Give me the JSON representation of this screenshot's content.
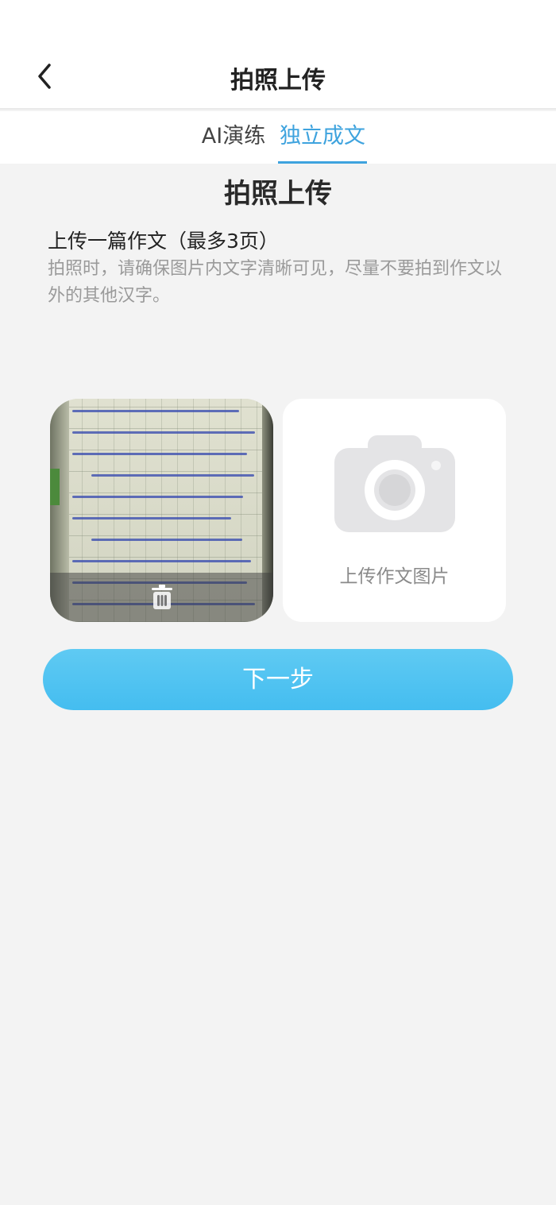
{
  "header": {
    "title": "拍照上传",
    "back_icon": "chevron-left-icon"
  },
  "tabs": [
    {
      "label": "AI演练",
      "active": false
    },
    {
      "label": "独立成文",
      "active": true
    }
  ],
  "main": {
    "section_title": "拍照上传",
    "upload_heading": "上传一篇作文（最多3页）",
    "upload_hint": "拍照时，请确保图片内文字清晰可见，尽量不要拍到作文以外的其他汉字。",
    "uploaded_images": [
      {
        "description_icon": "essay-photo-thumbnail",
        "delete_icon": "trash-icon"
      }
    ],
    "add_image": {
      "label": "上传作文图片",
      "icon": "camera-icon"
    },
    "next_button": "下一步"
  },
  "colors": {
    "accent": "#3ea3de",
    "button_gradient_top": "#5fcaf3",
    "button_gradient_bottom": "#44bdf0",
    "background": "#f3f3f3"
  }
}
